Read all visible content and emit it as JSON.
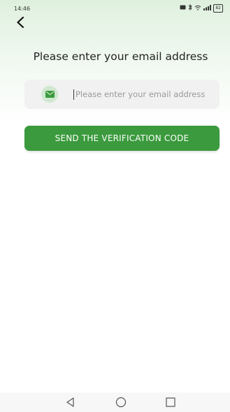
{
  "status_bar": {
    "time": "14:46",
    "battery": "82"
  },
  "back": {
    "icon": "chevron-left-icon"
  },
  "page": {
    "title": "Please enter your email address"
  },
  "email_field": {
    "icon": "mail-icon",
    "placeholder": "Please enter your email address",
    "value": ""
  },
  "actions": {
    "send_label": "SEND THE VERIFICATION CODE"
  },
  "colors": {
    "accent": "#3b9a3d",
    "icon_bg": "#cfe8cf",
    "field_bg": "#f1f1f1"
  },
  "nav_bar": {
    "back_icon": "triangle-back-icon",
    "home_icon": "circle-home-icon",
    "recents_icon": "square-recents-icon"
  }
}
